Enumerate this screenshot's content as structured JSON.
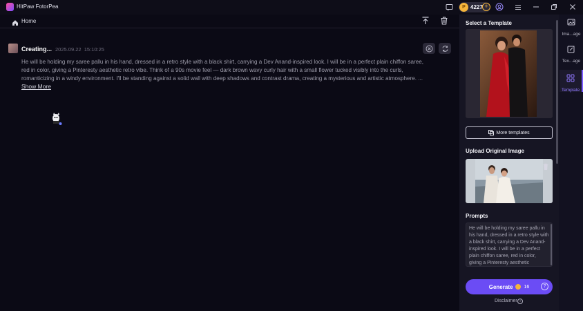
{
  "app": {
    "title": "HitPaw FotorPea",
    "credits": "4227"
  },
  "header": {
    "home_label": "Home"
  },
  "card": {
    "status": "Creating...",
    "date": "2025.09.22",
    "time": "15:10:25",
    "prompt_lines": [
      "He will be holding my saree pallu in his hand, dressed in a retro style with a black shirt, carrying a Dev Anand-inspired look. I will be in a perfect plain chiffon saree,",
      "red in color, giving a Pinteresty aesthetic retro vibe. Think of a 90s movie feel — dark brown wavy curly hair with a small flower tucked visibly into the curls,",
      "romanticizing in a windy environment. I'll be standing against a solid wall with deep shadows and contrast drama, creating a mysterious and artistic atmosphere. ..."
    ],
    "show_more": "Show More"
  },
  "panel": {
    "select_template_title": "Select a Template",
    "more_templates_label": "More templates",
    "upload_title": "Upload Original Image",
    "prompts_title": "Prompts",
    "prompt_box_text": "He will be holding my saree pallu in his hand, dressed in a retro style with a black shirt, carrying a Dev Anand-inspired look. I will be in a perfect plain chiffon saree, red in color, giving a Pinteresty aesthetic",
    "generate_label": "Generate",
    "generate_cost": "16",
    "disclaimer": "Disclaimer"
  },
  "rail": {
    "items": [
      {
        "label": "Ima...age"
      },
      {
        "label": "Tex...age"
      },
      {
        "label": "Template"
      }
    ]
  },
  "colors": {
    "accent": "#6b4cf5",
    "background": "#0b0a15",
    "panel": "#161523",
    "coin": "#f5b53b"
  }
}
